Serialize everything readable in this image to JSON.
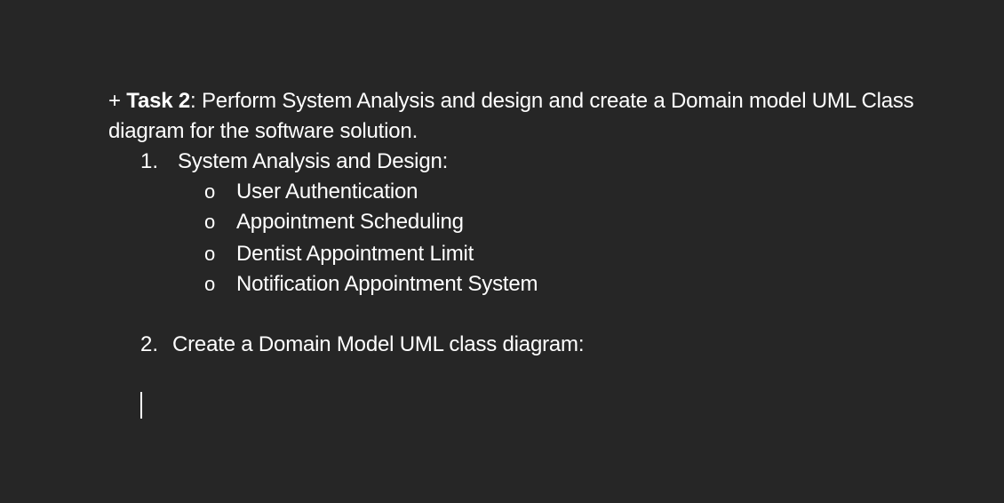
{
  "task": {
    "prefix": "+ ",
    "label": "Task 2",
    "text": ": Perform System Analysis and design and create a Domain model UML Class diagram for the software solution."
  },
  "list": {
    "item1": {
      "number": "1.",
      "label": "System Analysis and Design:",
      "subitems": [
        {
          "bullet": "o",
          "label": "User Authentication"
        },
        {
          "bullet": "o",
          "label": "Appointment Scheduling"
        },
        {
          "bullet": "o",
          "label": "Dentist Appointment Limit"
        },
        {
          "bullet": "o",
          "label": "Notification Appointment System"
        }
      ]
    },
    "item2": {
      "number": "2.",
      "label": "Create a Domain Model UML class diagram:"
    }
  }
}
